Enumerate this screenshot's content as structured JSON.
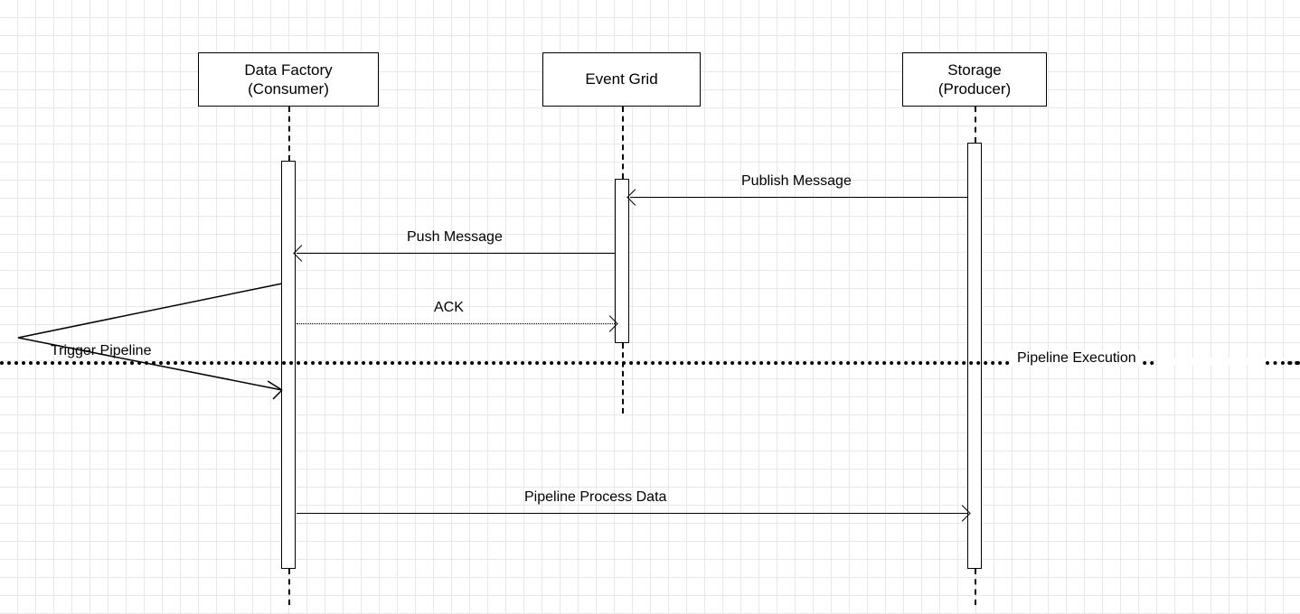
{
  "actors": {
    "dataFactory": {
      "line1": "Data Factory",
      "line2": "(Consumer)"
    },
    "eventGrid": {
      "line1": "Event Grid"
    },
    "storage": {
      "line1": "Storage",
      "line2": "(Producer)"
    }
  },
  "messages": {
    "publish": "Publish Message",
    "push": "Push Message",
    "ack": "ACK",
    "trigger": "Trigger Pipeline",
    "process": "Pipeline Process Data"
  },
  "divider": "Pipeline Execution"
}
